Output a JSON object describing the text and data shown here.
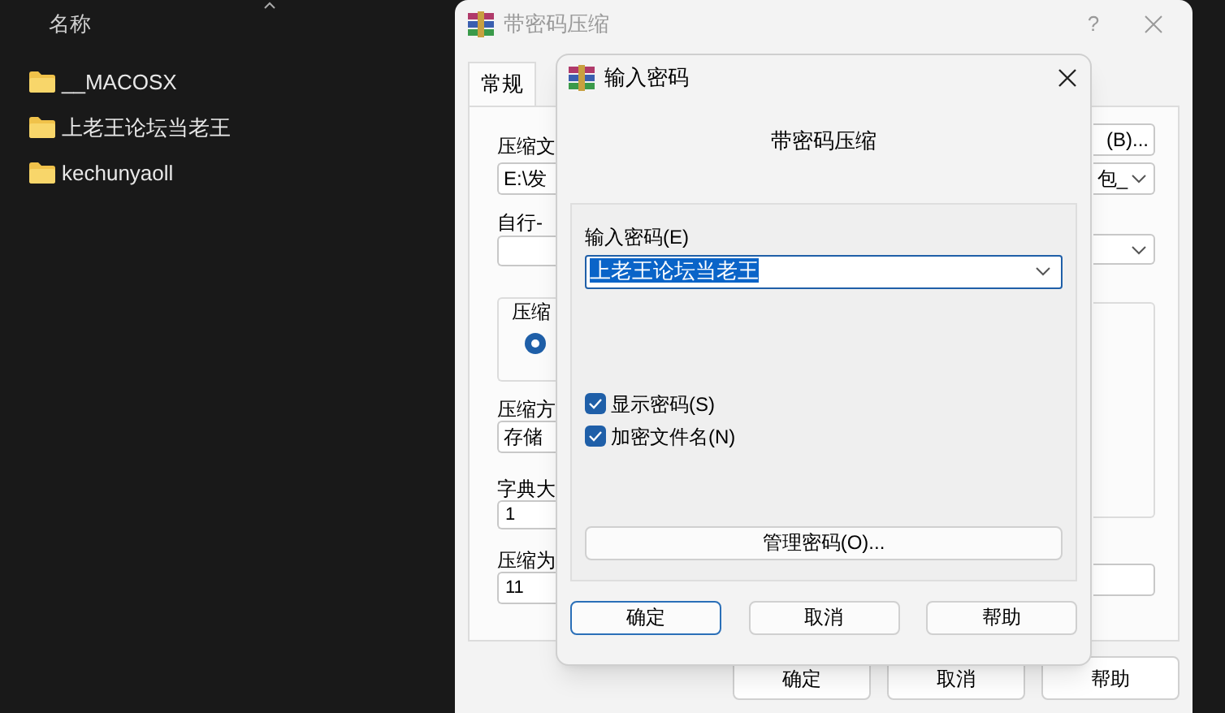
{
  "explorer": {
    "column_header": "名称",
    "items": [
      {
        "name": "__MACOSX"
      },
      {
        "name": "上老王论坛当老王"
      },
      {
        "name": "kechunyaoll"
      }
    ]
  },
  "main_dialog": {
    "title": "带密码压缩",
    "help": "?",
    "tab": {
      "label": "常规",
      "selected": true
    },
    "left": {
      "archive_label": "压缩文",
      "archive_value": "E:\\发",
      "profile_label": "自行-",
      "group_label": "压缩",
      "radio": {
        "selected": true
      },
      "method_label": "压缩方",
      "method_value": "存储",
      "dict_label": "字典大",
      "dict_value": "1",
      "split_label": "压缩为",
      "split_value": "11"
    },
    "right": {
      "browse_button": "(B)...",
      "archive_combo": "包_"
    },
    "buttons": [
      "确定",
      "取消",
      "帮助"
    ]
  },
  "password_dialog": {
    "title": "输入密码",
    "heading": "带密码压缩",
    "password_label": "输入密码(E)",
    "password_value": "上老王论坛当老王",
    "password_highlighted": true,
    "options": [
      {
        "label": "显示密码(S)",
        "checked": true
      },
      {
        "label": "加密文件名(N)",
        "checked": true
      }
    ],
    "manage_button": "管理密码(O)...",
    "buttons": [
      {
        "label": "确定",
        "default": true
      },
      {
        "label": "取消",
        "default": false
      },
      {
        "label": "帮助",
        "default": false
      }
    ]
  }
}
